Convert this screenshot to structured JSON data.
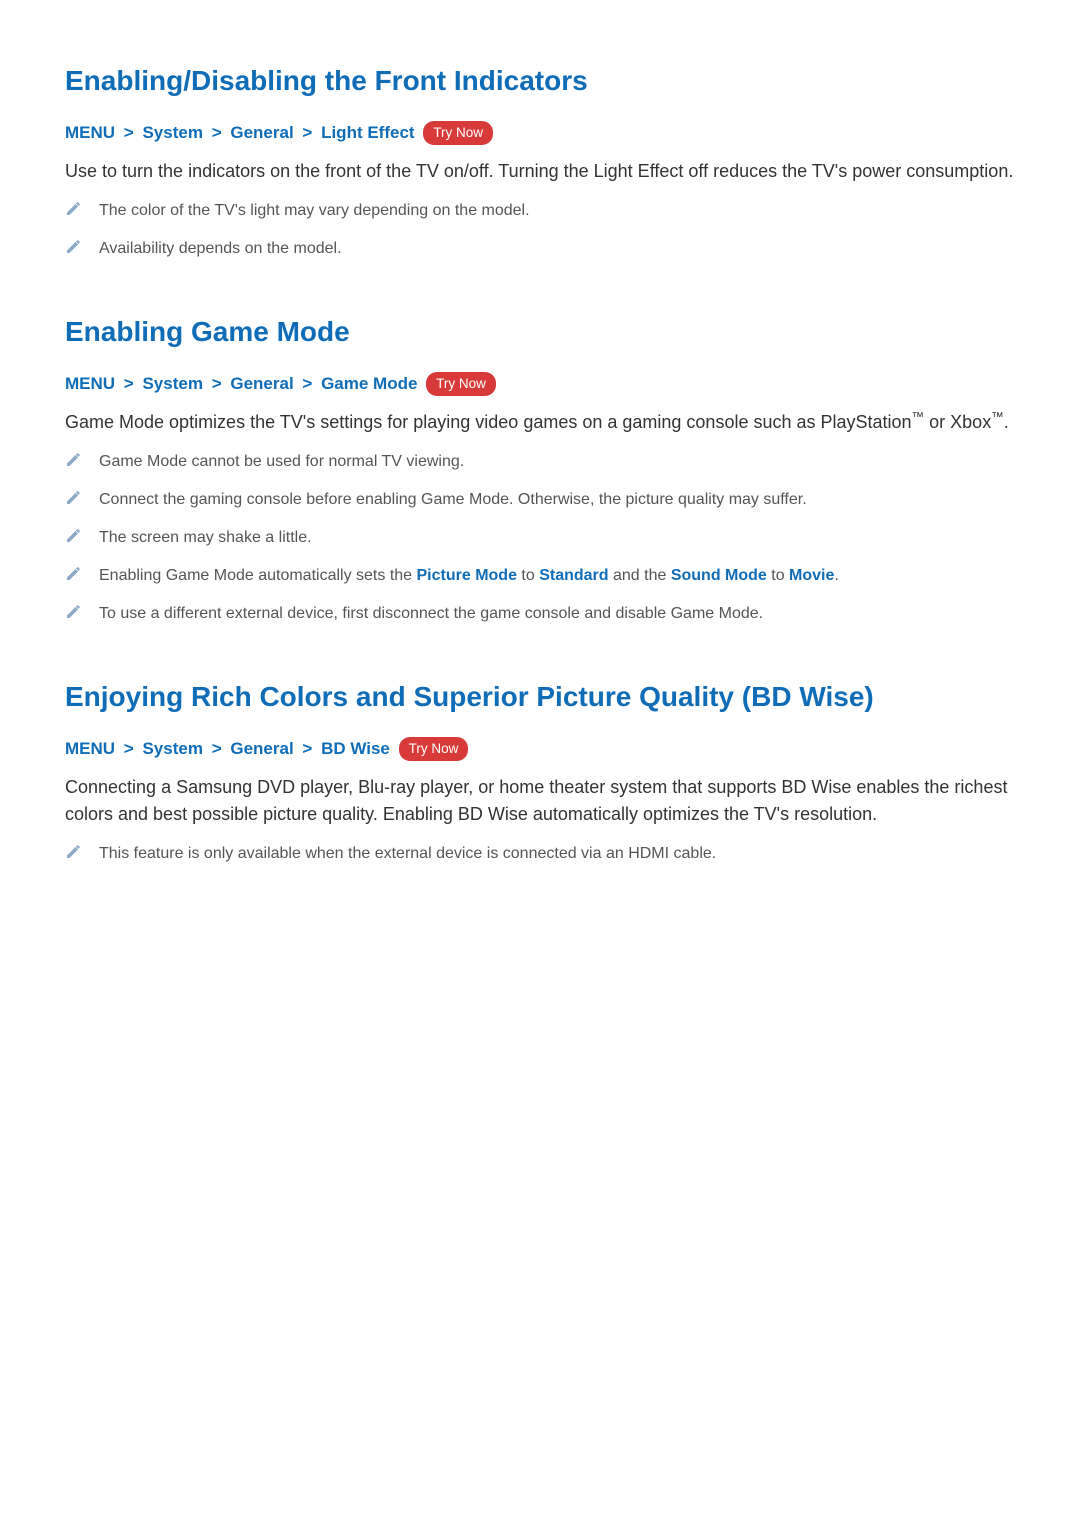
{
  "sections": [
    {
      "title": "Enabling/Disabling the Front Indicators",
      "breadcrumb": [
        "MENU",
        "System",
        "General",
        "Light Effect"
      ],
      "try_now": "Try Now",
      "body": "Use to turn the indicators on the front of the TV on/off. Turning the Light Effect off reduces the TV's power consumption.",
      "notes": [
        {
          "text": "The color of the TV's light may vary depending on the model."
        },
        {
          "text": "Availability depends on the model."
        }
      ]
    },
    {
      "title": "Enabling Game Mode",
      "breadcrumb": [
        "MENU",
        "System",
        "General",
        "Game Mode"
      ],
      "try_now": "Try Now",
      "body": "Game Mode optimizes the TV's settings for playing video games on a gaming console such as PlayStation™ or Xbox™.",
      "notes": [
        {
          "text": "Game Mode cannot be used for normal TV viewing."
        },
        {
          "text": "Connect the gaming console before enabling Game Mode. Otherwise, the picture quality may suffer."
        },
        {
          "text": "The screen may shake a little."
        },
        {
          "parts": [
            {
              "t": "Enabling Game Mode automatically sets the "
            },
            {
              "t": "Picture Mode",
              "term": true
            },
            {
              "t": " to "
            },
            {
              "t": "Standard",
              "term": true
            },
            {
              "t": " and the "
            },
            {
              "t": "Sound Mode",
              "term": true
            },
            {
              "t": " to "
            },
            {
              "t": "Movie",
              "term": true
            },
            {
              "t": "."
            }
          ]
        },
        {
          "text": "To use a different external device, first disconnect the game console and disable Game Mode."
        }
      ]
    },
    {
      "title": "Enjoying Rich Colors and Superior Picture Quality (BD Wise)",
      "breadcrumb": [
        "MENU",
        "System",
        "General",
        "BD Wise"
      ],
      "try_now": "Try Now",
      "body": "Connecting a Samsung DVD player, Blu-ray player, or home theater system that supports BD Wise enables the richest colors and best possible picture quality. Enabling BD Wise automatically optimizes the TV's resolution.",
      "notes": [
        {
          "text": "This feature is only available when the external device is connected via an HDMI cable."
        }
      ]
    }
  ],
  "chevron": ">"
}
